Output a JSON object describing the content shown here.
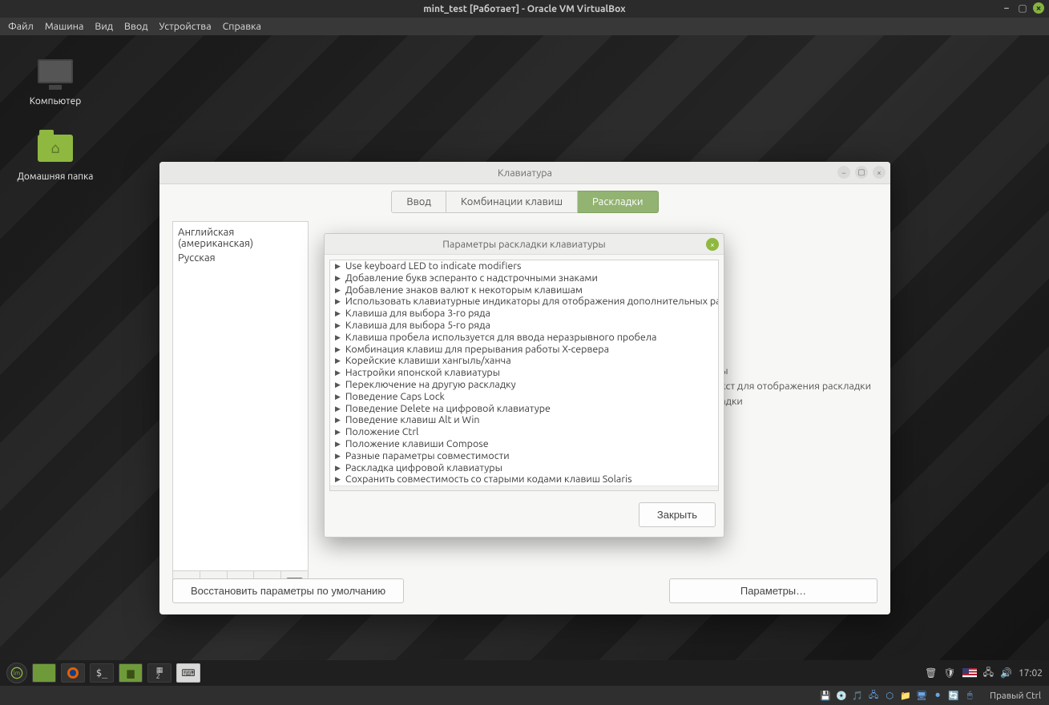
{
  "vbox": {
    "title": "mint_test [Работает] - Oracle VM VirtualBox",
    "menu": {
      "file": "Файл",
      "machine": "Машина",
      "view": "Вид",
      "input": "Ввод",
      "devices": "Устройства",
      "help": "Справка"
    },
    "status_host": "Правый Ctrl"
  },
  "desktop": {
    "computer": "Компьютер",
    "home": "Домашняя папка",
    "clock": "17:02"
  },
  "keyboard_window": {
    "title": "Клавиатура",
    "tabs": {
      "typing": "Ввод",
      "shortcuts": "Комбинации клавиш",
      "layouts": "Раскладки"
    },
    "layouts": [
      "Английская (американская)",
      "Русская"
    ],
    "hint_line1": "ы",
    "hint_line2": "кст для отображения раскладки",
    "hint_line3": "адки",
    "restore": "Восстановить параметры по умолчанию",
    "options": "Параметры…",
    "toolbar": {
      "add": "+",
      "remove": "−",
      "up": "↑",
      "down": "↓",
      "preview": "⌨"
    }
  },
  "dialog": {
    "title": "Параметры раскладки клавиатуры",
    "close_label": "Закрыть",
    "items": [
      "Use keyboard LED to indicate modifiers",
      "Добавление букв эсперанто с надстрочными знаками",
      "Добавление знаков валют к некоторым клавишам",
      "Использовать клавиатурные индикаторы для отображения дополнительных ра",
      "Клавиша для выбора 3-го ряда",
      "Клавиша для выбора 5-го ряда",
      "Клавиша пробела используется для ввода неразрывного пробела",
      "Комбинация клавиш для прерывания работы X-сервера",
      "Корейские клавиши хангыль/ханча",
      "Настройки японской клавиатуры",
      "Переключение на другую раскладку",
      "Поведение Caps Lock",
      "Поведение Delete на цифровой клавиатуре",
      "Поведение клавиш Alt и Win",
      "Положение Ctrl",
      "Положение клавиши Compose",
      "Разные параметры совместимости",
      "Раскладка цифровой клавиатуры",
      "Сохранить совместимость со старыми кодами клавиш Solaris"
    ]
  }
}
